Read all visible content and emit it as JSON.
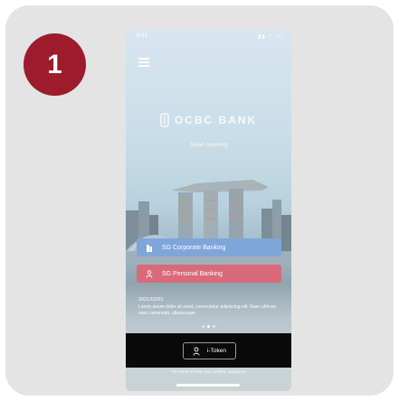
{
  "step": {
    "number": "1"
  },
  "status_bar": {
    "time": "9:41",
    "icons": "▮▮ ◠ ▭"
  },
  "brand": {
    "name": "OCBC BANK",
    "tagline": "Good morning"
  },
  "buttons": {
    "corporate": "SG Corporate Banking",
    "personal": "SG Personal Banking"
  },
  "news": {
    "date": "2021/02/01",
    "body": "Lorem ipsum dolor sit amet, consectetur adipiscing elit. Nunc ultrices nunc commodo, ullamcorper."
  },
  "pager": {
    "count": 3,
    "active_index": 1
  },
  "itoken": {
    "label": "i-Token"
  },
  "footer": {
    "text": "The Bank of East Asia Limited, Singapore"
  },
  "colors": {
    "badge": "#9c1c2b",
    "corporate_button": "#7fa6d8",
    "personal_button": "#d86a7a",
    "bottom_bar": "#0a0a0a",
    "card_background": "#e4e4e4"
  },
  "icons": {
    "menu": "menu-icon",
    "logo": "bank-logo-icon",
    "corporate": "building-icon",
    "personal": "person-icon",
    "itoken": "token-device-icon"
  }
}
